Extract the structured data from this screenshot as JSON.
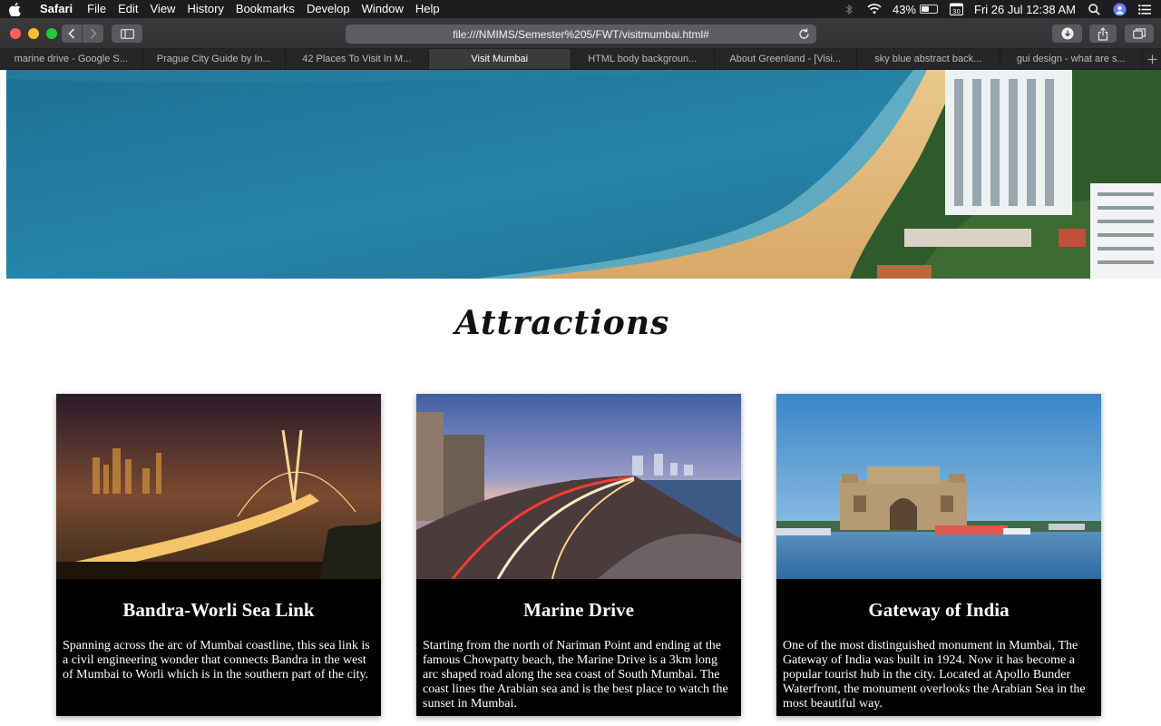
{
  "menubar": {
    "app_name": "Safari",
    "items": [
      "File",
      "Edit",
      "View",
      "History",
      "Bookmarks",
      "Develop",
      "Window",
      "Help"
    ],
    "battery_percent": "43%",
    "datetime": "Fri 26 Jul  12:38 AM",
    "calendar_day": "30"
  },
  "toolbar": {
    "url": "file:///NMIMS/Semester%205/FWT/visitmumbai.html#"
  },
  "tabs": [
    {
      "label": "marine drive - Google S..."
    },
    {
      "label": "Prague City Guide by In..."
    },
    {
      "label": "42 Places To Visit In M..."
    },
    {
      "label": "Visit Mumbai"
    },
    {
      "label": "HTML body backgroun..."
    },
    {
      "label": "About Greenland - [Visi..."
    },
    {
      "label": "sky blue abstract back..."
    },
    {
      "label": "gui design - what are s..."
    }
  ],
  "page": {
    "heading": "Attractions",
    "cards": [
      {
        "title": "Bandra-Worli Sea Link",
        "text": "Spanning across the arc of Mumbai coastline, this sea link is a civil engineering wonder that connects Bandra in the west of Mumbai to Worli which is in the southern part of the city."
      },
      {
        "title": "Marine Drive",
        "text": "Starting from the north of Nariman Point and ending at the famous Chowpatty beach, the Marine Drive is a 3km long arc shaped road along the sea coast of South Mumbai. The coast lines the Arabian sea and is the best place to watch the sunset in Mumbai."
      },
      {
        "title": "Gateway of India",
        "text": "One of the most distinguished monument in Mumbai, The Gateway of India was built in 1924. Now it has become a popular tourist hub in the city. Located at Apollo Bunder Waterfront, the monument overlooks the Arabian Sea in the most beautiful way."
      }
    ]
  }
}
